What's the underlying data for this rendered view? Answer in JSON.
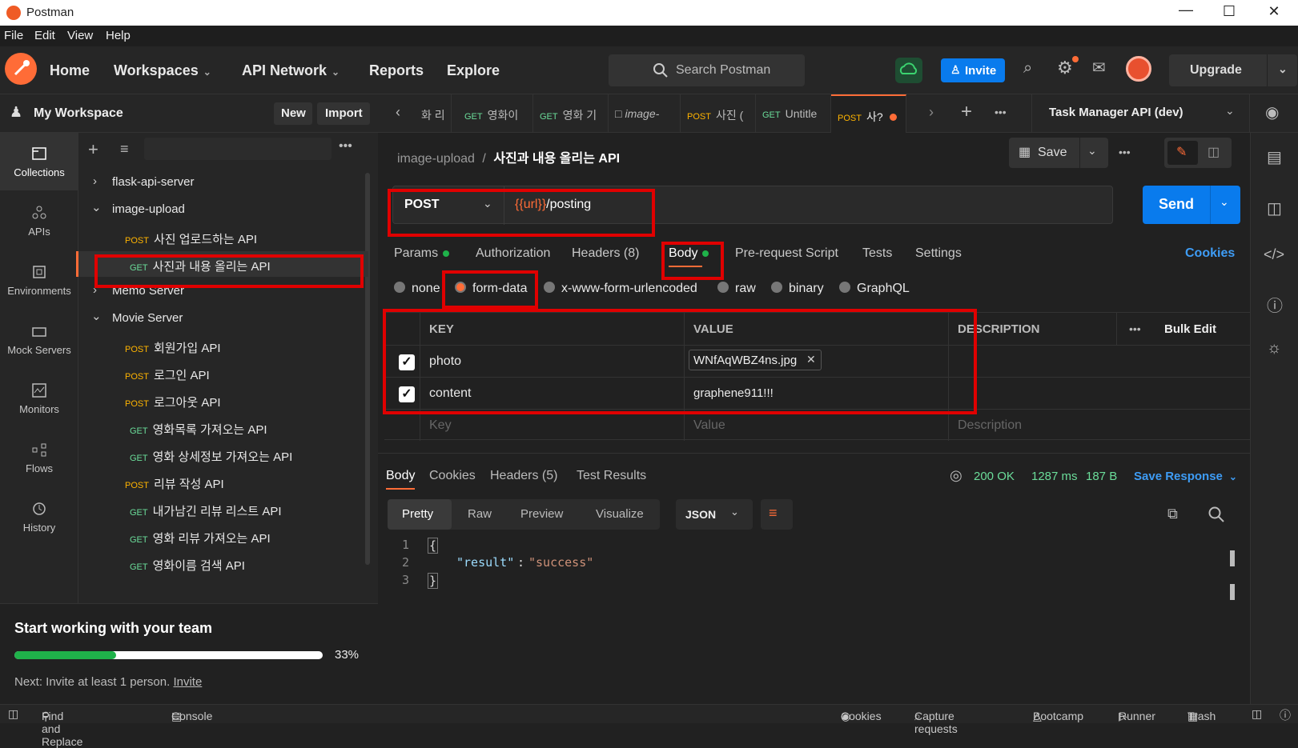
{
  "window": {
    "title": "Postman"
  },
  "menu": [
    "File",
    "Edit",
    "View",
    "Help"
  ],
  "header": {
    "nav": [
      "Home",
      "Workspaces",
      "API Network",
      "Reports",
      "Explore"
    ],
    "search_placeholder": "Search Postman",
    "invite": "Invite",
    "upgrade": "Upgrade"
  },
  "workspace": {
    "name": "My Workspace",
    "new": "New",
    "import": "Import"
  },
  "rail": [
    "Collections",
    "APIs",
    "Environments",
    "Mock Servers",
    "Monitors",
    "Flows",
    "History"
  ],
  "tree": {
    "collections": [
      {
        "name": "flask-api-server",
        "expanded": false
      },
      {
        "name": "image-upload",
        "expanded": true
      },
      {
        "name": "Memo Server",
        "expanded": false
      },
      {
        "name": "Movie Server",
        "expanded": true
      }
    ],
    "image_upload_items": [
      {
        "method": "POST",
        "name": "사진 업로드하는 API"
      },
      {
        "method": "GET",
        "name": "사진과 내용 올리는 API"
      }
    ],
    "movie_items": [
      {
        "method": "POST",
        "name": "회원가입 API"
      },
      {
        "method": "POST",
        "name": "로그인 API"
      },
      {
        "method": "POST",
        "name": "로그아웃 API"
      },
      {
        "method": "GET",
        "name": "영화목록 가져오는 API"
      },
      {
        "method": "GET",
        "name": "영화 상세정보 가져오는 API"
      },
      {
        "method": "POST",
        "name": "리뷰 작성 API"
      },
      {
        "method": "GET",
        "name": "내가남긴 리뷰 리스트 API"
      },
      {
        "method": "GET",
        "name": "영화 리뷰 가져오는 API"
      },
      {
        "method": "GET",
        "name": "영화이름 검색 API"
      }
    ]
  },
  "onboarding": {
    "title": "Start working with your team",
    "progress_percent": 33,
    "progress_label": "33%",
    "next_text": "Next: Invite at least 1 person.",
    "invite_link": "Invite"
  },
  "tabs": [
    {
      "method": "",
      "label": "화 리"
    },
    {
      "method": "GET",
      "label": "영화이"
    },
    {
      "method": "GET",
      "label": "영화 기"
    },
    {
      "method": "",
      "label": "image-"
    },
    {
      "method": "POST",
      "label": "사진 ("
    },
    {
      "method": "GET",
      "label": "Untitle"
    },
    {
      "method": "POST",
      "label": "사?"
    }
  ],
  "environment": "Task Manager API (dev)",
  "breadcrumb": {
    "collection": "image-upload",
    "separator": "/",
    "request": "사진과 내용 올리는 API"
  },
  "request": {
    "save": "Save",
    "method": "POST",
    "url_var": "{{url}}",
    "url_path": "/posting",
    "send": "Send",
    "subtabs": [
      "Params",
      "Authorization",
      "Headers (8)",
      "Body",
      "Pre-request Script",
      "Tests",
      "Settings"
    ],
    "cookies": "Cookies",
    "body_modes": [
      "none",
      "form-data",
      "x-www-form-urlencoded",
      "raw",
      "binary",
      "GraphQL"
    ],
    "table_headers": [
      "KEY",
      "VALUE",
      "DESCRIPTION"
    ],
    "bulk_edit": "Bulk Edit",
    "rows": [
      {
        "key": "photo",
        "value": "WNfAqWBZ4ns.jpg"
      },
      {
        "key": "content",
        "value": "graphene911!!!"
      }
    ],
    "placeholders": {
      "key": "Key",
      "value": "Value",
      "description": "Description"
    }
  },
  "response": {
    "tabs": [
      "Body",
      "Cookies",
      "Headers (5)",
      "Test Results"
    ],
    "status": "200 OK",
    "time": "1287 ms",
    "size": "187 B",
    "save_response": "Save Response",
    "views": [
      "Pretty",
      "Raw",
      "Preview",
      "Visualize"
    ],
    "format": "JSON",
    "lines": [
      "1",
      "2",
      "3"
    ],
    "code_open": "{",
    "code_key": "\"result\"",
    "code_colon": ":",
    "code_value": "\"success\"",
    "code_close": "}"
  },
  "statusbar": {
    "left": [
      "Find and Replace",
      "Console"
    ],
    "right": [
      "Cookies",
      "Capture requests",
      "Bootcamp",
      "Runner",
      "Trash"
    ]
  },
  "colors": {
    "accent": "#ff6c37",
    "send": "#097bed",
    "highlight": "#e00000",
    "success": "#6bdd9a"
  }
}
